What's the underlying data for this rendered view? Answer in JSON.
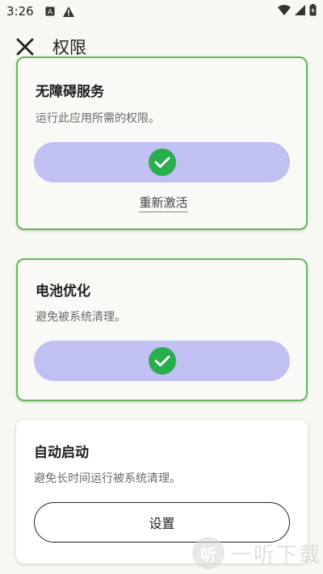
{
  "status_bar": {
    "time": "3:26"
  },
  "toolbar": {
    "title": "权限"
  },
  "cards": [
    {
      "title": "无障碍服务",
      "description": "运行此应用所需的权限。",
      "state": "granted",
      "link": "重新激活"
    },
    {
      "title": "电池优化",
      "description": "避免被系统清理。",
      "state": "granted"
    },
    {
      "title": "自动启动",
      "description": "避免长时间运行被系统清理。",
      "state": "not-granted",
      "button_label": "设置"
    }
  ],
  "watermark": {
    "logo_text": "听",
    "text": "一听下载"
  },
  "colors": {
    "granted_border": "#67b85a",
    "pill": "#c0c0f2",
    "check": "#27ae4e"
  }
}
